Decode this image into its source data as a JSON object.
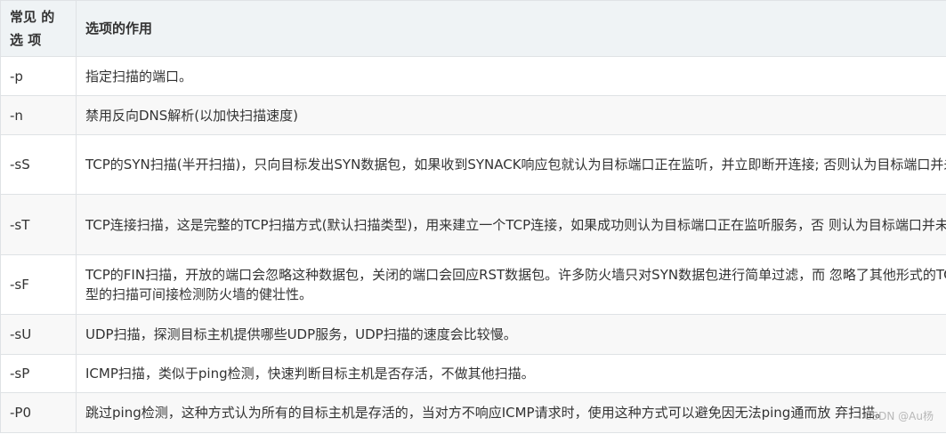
{
  "table": {
    "headers": [
      "常见 的 选 项",
      "选项的作用"
    ],
    "rows": [
      {
        "option": "-p",
        "description": "指定扫描的端口。"
      },
      {
        "option": "-n",
        "description": "禁用反向DNS解析(以加快扫描速度)"
      },
      {
        "option": "-sS",
        "description": "TCP的SYN扫描(半开扫描)，只向目标发出SYN数据包，如果收到SYNACK响应包就认为目标端口正在监听，并立即断开连接; 否则认为目标端口并未开放。"
      },
      {
        "option": "-sT",
        "description": "TCP连接扫描，这是完整的TCP扫描方式(默认扫描类型)，用来建立一个TCP连接，如果成功则认为目标端口正在监听服务，否 则认为目标端口并未开放。"
      },
      {
        "option": "-sF",
        "description": "TCP的FIN扫描，开放的端口会忽略这种数据包，关闭的端口会回应RST数据包。许多防火墙只对SYN数据包进行简单过滤，而 忽略了其他形式的TCP攻击包。这种类型的扫描可间接检测防火墙的健壮性。"
      },
      {
        "option": "-sU",
        "description": "UDP扫描，探测目标主机提供哪些UDP服务，UDP扫描的速度会比较慢。"
      },
      {
        "option": "-sP",
        "description": "ICMP扫描，类似于ping检测，快速判断目标主机是否存活，不做其他扫描。"
      },
      {
        "option": "-P0",
        "description": "跳过ping检测，这种方式认为所有的目标主机是存活的，当对方不响应ICMP请求时，使用这种方式可以避免因无法ping通而放 弃扫描。"
      }
    ]
  },
  "watermark": "CSDN @Au杨"
}
